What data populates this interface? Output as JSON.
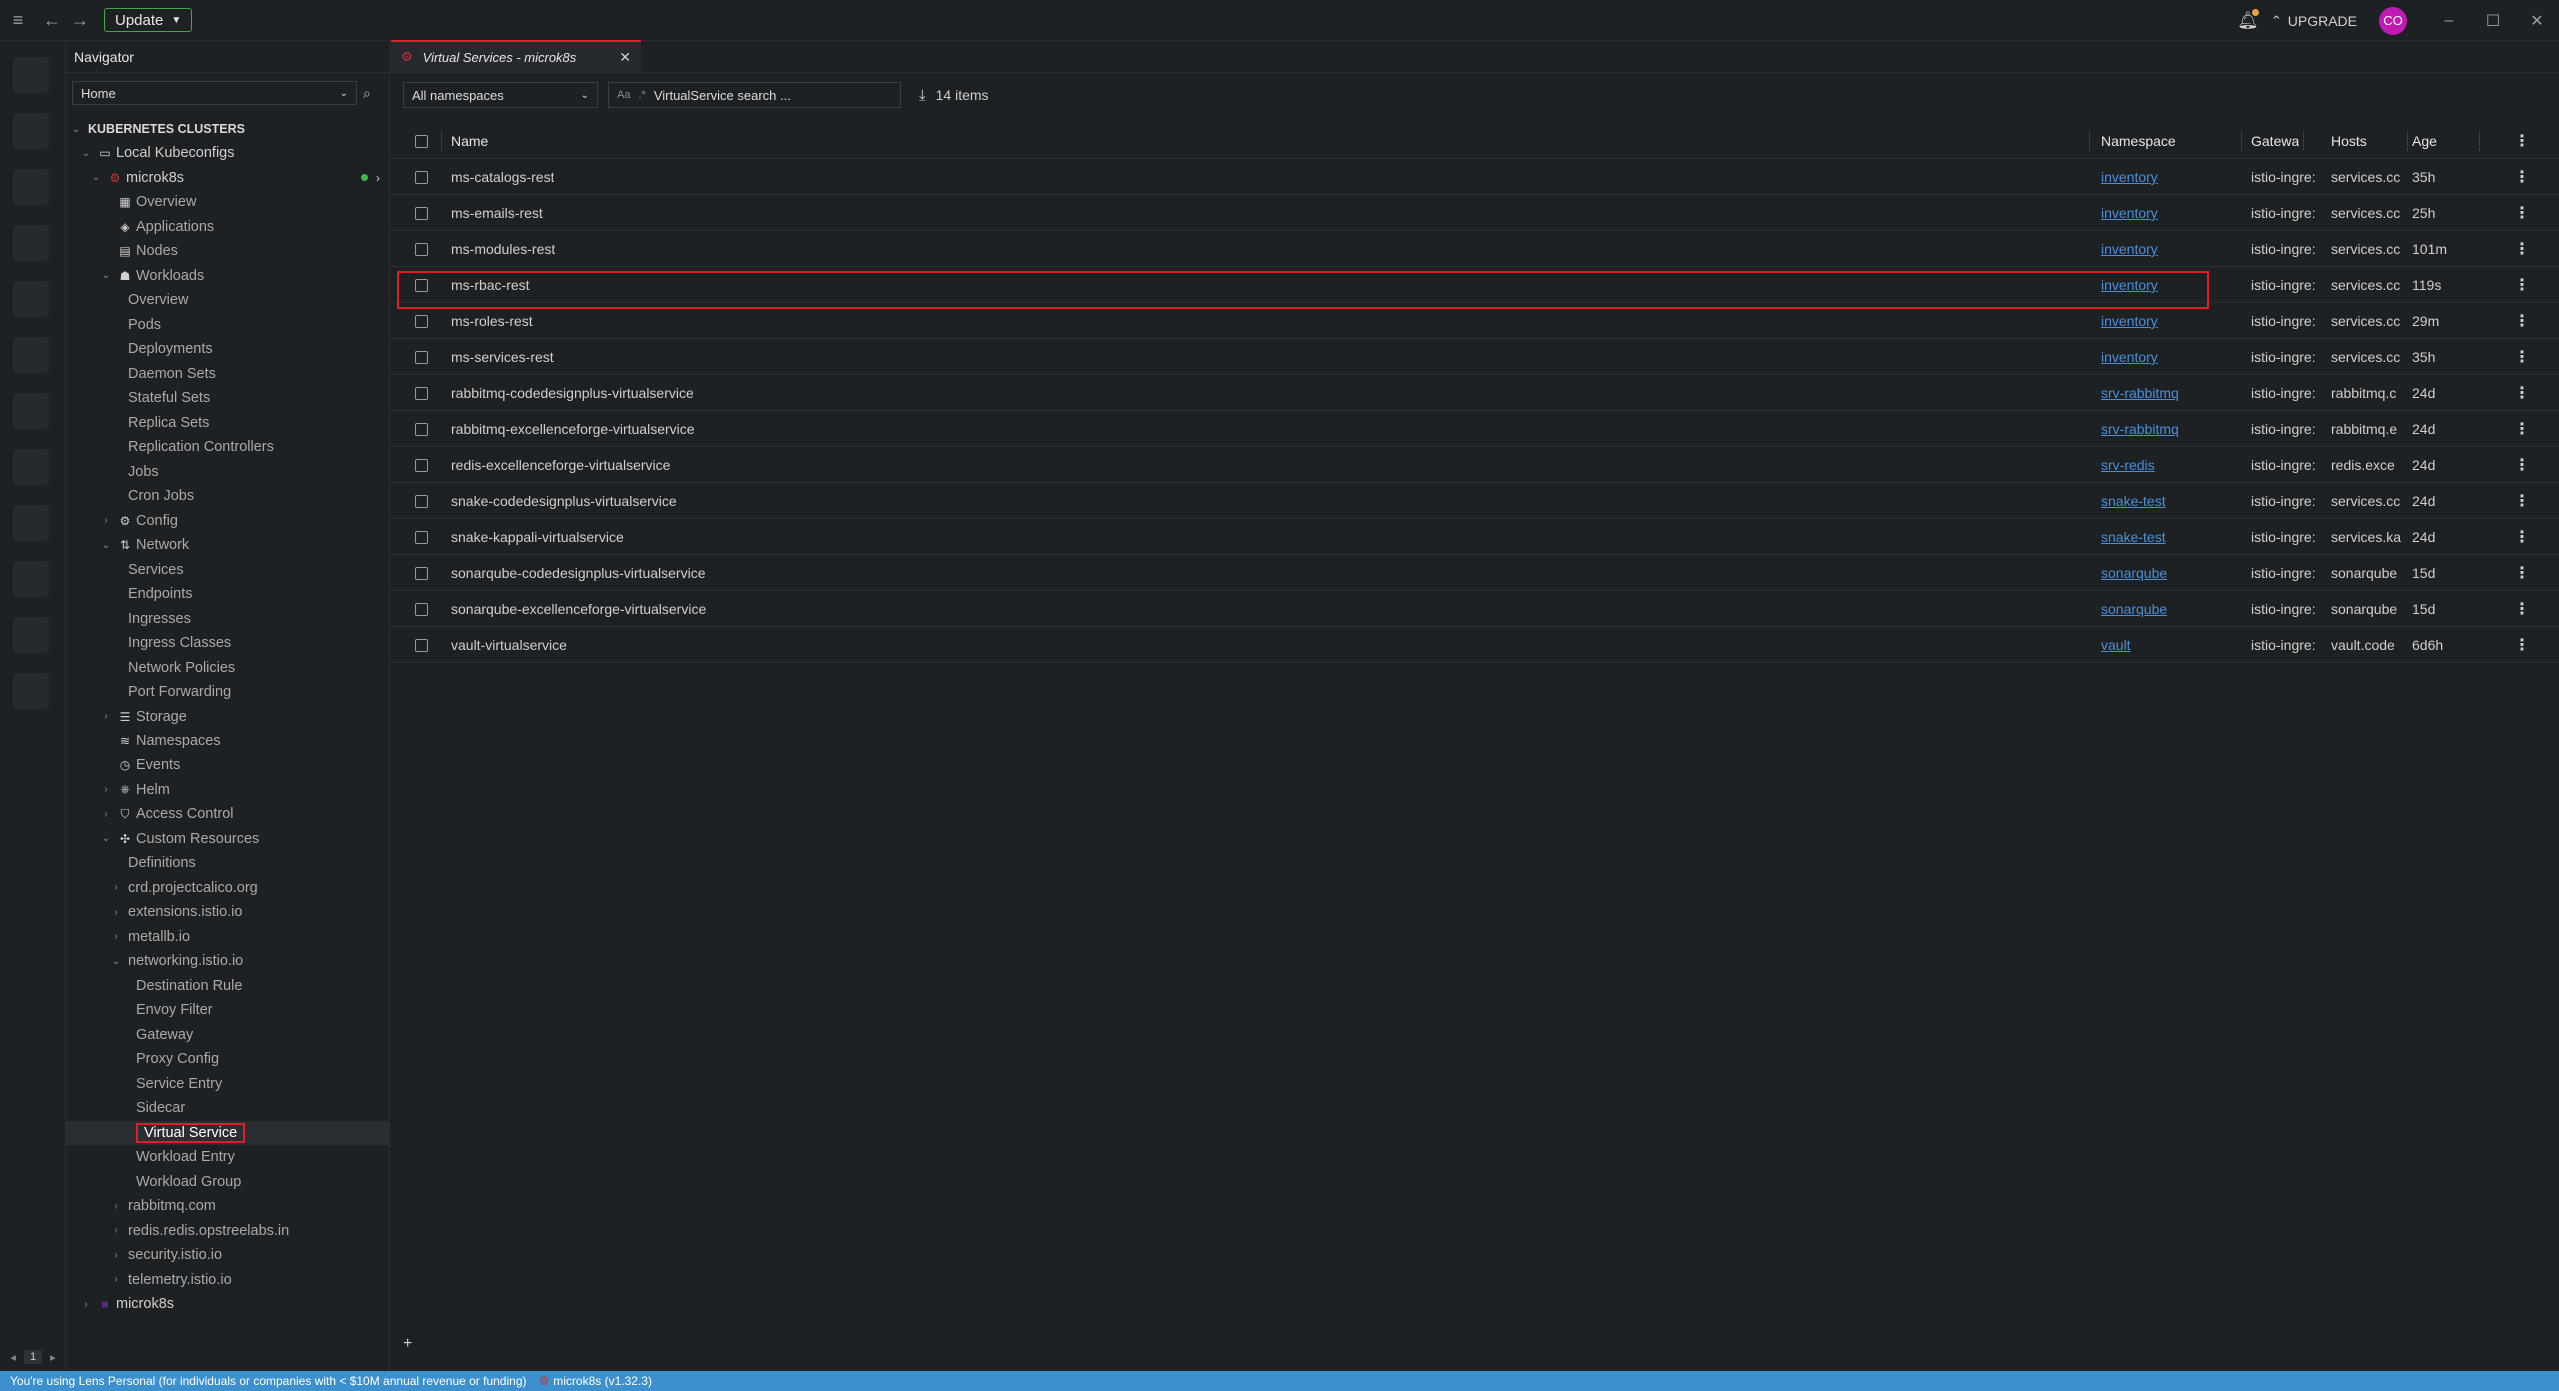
{
  "titlebar": {
    "update_label": "Update",
    "upgrade_label": "UPGRADE",
    "avatar_initials": "CO"
  },
  "navigator": {
    "title": "Navigator",
    "location_select": "Home",
    "tree": [
      {
        "label": "KUBERNETES CLUSTERS",
        "depth": 0,
        "arrow": "down",
        "icon": "",
        "section": true
      },
      {
        "label": "Local Kubeconfigs",
        "depth": 1,
        "arrow": "down",
        "icon": "laptop-icon"
      },
      {
        "label": "microk8s",
        "depth": 2,
        "arrow": "down",
        "icon": "cluster-icon",
        "cluster": true
      },
      {
        "label": "Overview",
        "depth": 3,
        "arrow": "",
        "icon": "grid-icon"
      },
      {
        "label": "Applications",
        "depth": 3,
        "arrow": "",
        "icon": "layers-icon"
      },
      {
        "label": "Nodes",
        "depth": 3,
        "arrow": "",
        "icon": "nodes-icon"
      },
      {
        "label": "Workloads",
        "depth": 3,
        "arrow": "down",
        "icon": "workloads-icon"
      },
      {
        "label": "Overview",
        "depth": 4,
        "arrow": "",
        "icon": ""
      },
      {
        "label": "Pods",
        "depth": 4,
        "arrow": "",
        "icon": ""
      },
      {
        "label": "Deployments",
        "depth": 4,
        "arrow": "",
        "icon": ""
      },
      {
        "label": "Daemon Sets",
        "depth": 4,
        "arrow": "",
        "icon": ""
      },
      {
        "label": "Stateful Sets",
        "depth": 4,
        "arrow": "",
        "icon": ""
      },
      {
        "label": "Replica Sets",
        "depth": 4,
        "arrow": "",
        "icon": ""
      },
      {
        "label": "Replication Controllers",
        "depth": 4,
        "arrow": "",
        "icon": ""
      },
      {
        "label": "Jobs",
        "depth": 4,
        "arrow": "",
        "icon": ""
      },
      {
        "label": "Cron Jobs",
        "depth": 4,
        "arrow": "",
        "icon": ""
      },
      {
        "label": "Config",
        "depth": 3,
        "arrow": "right",
        "icon": "config-icon"
      },
      {
        "label": "Network",
        "depth": 3,
        "arrow": "down",
        "icon": "network-icon"
      },
      {
        "label": "Services",
        "depth": 4,
        "arrow": "",
        "icon": ""
      },
      {
        "label": "Endpoints",
        "depth": 4,
        "arrow": "",
        "icon": ""
      },
      {
        "label": "Ingresses",
        "depth": 4,
        "arrow": "",
        "icon": ""
      },
      {
        "label": "Ingress Classes",
        "depth": 4,
        "arrow": "",
        "icon": ""
      },
      {
        "label": "Network Policies",
        "depth": 4,
        "arrow": "",
        "icon": ""
      },
      {
        "label": "Port Forwarding",
        "depth": 4,
        "arrow": "",
        "icon": ""
      },
      {
        "label": "Storage",
        "depth": 3,
        "arrow": "right",
        "icon": "storage-icon"
      },
      {
        "label": "Namespaces",
        "depth": 3,
        "arrow": "",
        "icon": "namespaces-icon"
      },
      {
        "label": "Events",
        "depth": 3,
        "arrow": "",
        "icon": "clock-icon"
      },
      {
        "label": "Helm",
        "depth": 3,
        "arrow": "right",
        "icon": "helm-icon"
      },
      {
        "label": "Access Control",
        "depth": 3,
        "arrow": "right",
        "icon": "shield-icon"
      },
      {
        "label": "Custom Resources",
        "depth": 3,
        "arrow": "down",
        "icon": "puzzle-icon"
      },
      {
        "label": "Definitions",
        "depth": 4,
        "arrow": "",
        "icon": ""
      },
      {
        "label": "crd.projectcalico.org",
        "depth": 4,
        "arrow": "right",
        "icon": ""
      },
      {
        "label": "extensions.istio.io",
        "depth": 4,
        "arrow": "right",
        "icon": ""
      },
      {
        "label": "metallb.io",
        "depth": 4,
        "arrow": "right",
        "icon": ""
      },
      {
        "label": "networking.istio.io",
        "depth": 4,
        "arrow": "down",
        "icon": ""
      },
      {
        "label": "Destination Rule",
        "depth": 5,
        "arrow": "",
        "icon": ""
      },
      {
        "label": "Envoy Filter",
        "depth": 5,
        "arrow": "",
        "icon": ""
      },
      {
        "label": "Gateway",
        "depth": 5,
        "arrow": "",
        "icon": ""
      },
      {
        "label": "Proxy Config",
        "depth": 5,
        "arrow": "",
        "icon": ""
      },
      {
        "label": "Service Entry",
        "depth": 5,
        "arrow": "",
        "icon": ""
      },
      {
        "label": "Sidecar",
        "depth": 5,
        "arrow": "",
        "icon": ""
      },
      {
        "label": "Virtual Service",
        "depth": 5,
        "arrow": "",
        "icon": "",
        "active": true
      },
      {
        "label": "Workload Entry",
        "depth": 5,
        "arrow": "",
        "icon": ""
      },
      {
        "label": "Workload Group",
        "depth": 5,
        "arrow": "",
        "icon": ""
      },
      {
        "label": "rabbitmq.com",
        "depth": 4,
        "arrow": "right",
        "icon": ""
      },
      {
        "label": "redis.redis.opstreelabs.in",
        "depth": 4,
        "arrow": "right",
        "icon": ""
      },
      {
        "label": "security.istio.io",
        "depth": 4,
        "arrow": "right",
        "icon": ""
      },
      {
        "label": "telemetry.istio.io",
        "depth": 4,
        "arrow": "right",
        "icon": ""
      },
      {
        "label": "microk8s",
        "depth": 1,
        "arrow": "right",
        "icon": "cluster-purple-icon"
      }
    ]
  },
  "hotbar": {
    "page": "1"
  },
  "tab": {
    "title": "Virtual Services - microk8s"
  },
  "toolbar": {
    "namespace_select": "All namespaces",
    "search_placeholder": "VirtualService search ...",
    "search_option": "Aa",
    "item_count": "14 items"
  },
  "table": {
    "columns": {
      "name": "Name",
      "namespace": "Namespace",
      "gateways": "Gatewa",
      "hosts": "Hosts",
      "age": "Age"
    },
    "rows": [
      {
        "name": "ms-catalogs-rest",
        "namespace": "inventory",
        "gateways": "istio-ingre:",
        "hosts": "services.cc",
        "age": "35h"
      },
      {
        "name": "ms-emails-rest",
        "namespace": "inventory",
        "gateways": "istio-ingre:",
        "hosts": "services.cc",
        "age": "25h"
      },
      {
        "name": "ms-modules-rest",
        "namespace": "inventory",
        "gateways": "istio-ingre:",
        "hosts": "services.cc",
        "age": "101m"
      },
      {
        "name": "ms-rbac-rest",
        "namespace": "inventory",
        "gateways": "istio-ingre:",
        "hosts": "services.cc",
        "age": "119s"
      },
      {
        "name": "ms-roles-rest",
        "namespace": "inventory",
        "gateways": "istio-ingre:",
        "hosts": "services.cc",
        "age": "29m"
      },
      {
        "name": "ms-services-rest",
        "namespace": "inventory",
        "gateways": "istio-ingre:",
        "hosts": "services.cc",
        "age": "35h"
      },
      {
        "name": "rabbitmq-codedesignplus-virtualservice",
        "namespace": "srv-rabbitmq",
        "gateways": "istio-ingre:",
        "hosts": "rabbitmq.c",
        "age": "24d"
      },
      {
        "name": "rabbitmq-excellenceforge-virtualservice",
        "namespace": "srv-rabbitmq",
        "gateways": "istio-ingre:",
        "hosts": "rabbitmq.e",
        "age": "24d"
      },
      {
        "name": "redis-excellenceforge-virtualservice",
        "namespace": "srv-redis",
        "gateways": "istio-ingre:",
        "hosts": "redis.exce",
        "age": "24d"
      },
      {
        "name": "snake-codedesignplus-virtualservice",
        "namespace": "snake-test",
        "gateways": "istio-ingre:",
        "hosts": "services.cc",
        "age": "24d"
      },
      {
        "name": "snake-kappali-virtualservice",
        "namespace": "snake-test",
        "gateways": "istio-ingre:",
        "hosts": "services.ka",
        "age": "24d"
      },
      {
        "name": "sonarqube-codedesignplus-virtualservice",
        "namespace": "sonarqube",
        "gateways": "istio-ingre:",
        "hosts": "sonarqube",
        "age": "15d"
      },
      {
        "name": "sonarqube-excellenceforge-virtualservice",
        "namespace": "sonarqube",
        "gateways": "istio-ingre:",
        "hosts": "sonarqube",
        "age": "15d"
      },
      {
        "name": "vault-virtualservice",
        "namespace": "vault",
        "gateways": "istio-ingre:",
        "hosts": "vault.code",
        "age": "6d6h"
      }
    ]
  },
  "statusbar": {
    "license_text": "You're using Lens Personal (for individuals or companies with < $10M annual revenue or funding)",
    "cluster_text": "microk8s (v1.32.3)"
  },
  "colors": {
    "background": "#1e2124",
    "highlight_red": "#e02020",
    "link_blue": "#4a90d9",
    "status_blue": "#3d90ce",
    "update_green": "#48a548",
    "avatar_magenta": "#c21bb5"
  }
}
